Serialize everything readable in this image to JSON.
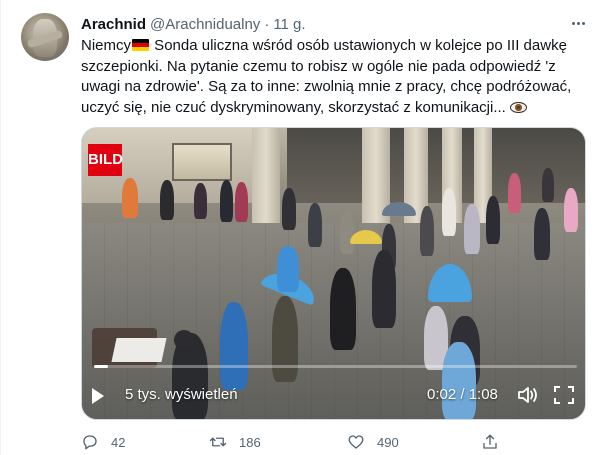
{
  "tweet": {
    "author_name": "Arachnid",
    "author_handle": "@Arachnidualny",
    "separator": "·",
    "time": "11 g.",
    "more_icon": "more-horizontal-icon",
    "text_line1_a": "Niemcy",
    "text_line1_b": " Sonda uliczna wśród osób ustawionych w kolejce po III dawkę",
    "text_line2": "szczepionki. Na pytanie czemu to robisz w ogóle nie pada odpowiedź 'z",
    "text_line3": "uwagi na zdrowie'. Są za to inne: zwolnią mnie z pracy, chcę podróżować,",
    "text_line4": "uczyć się, nie czuć dyskryminowany, skorzystać z komunikacji...",
    "flag_colors": [
      "#000000",
      "#dd0000",
      "#ffce00"
    ],
    "eye_icon": "eye-emoji-icon"
  },
  "video": {
    "logo_text": "BILD",
    "views": "5 tys. wyświetleń",
    "timecode": "0:02 / 1:08",
    "progress_fraction": 0.03,
    "play_icon": "play-icon",
    "volume_icon": "volume-icon",
    "fullscreen_icon": "fullscreen-icon"
  },
  "actions": {
    "reply_count": "42",
    "retweet_count": "186",
    "like_count": "490",
    "reply_icon": "reply-icon",
    "retweet_icon": "retweet-icon",
    "like_icon": "heart-icon",
    "share_icon": "share-icon"
  },
  "colors": {
    "text": "#0f1419",
    "secondary": "#536471",
    "umbrella_blue": "#4aa3df",
    "bild_red": "#e1000f"
  }
}
